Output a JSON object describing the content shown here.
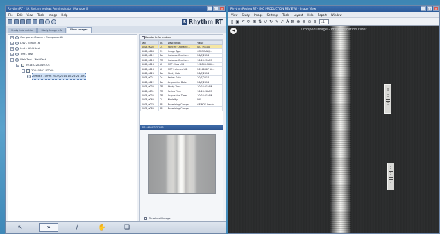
{
  "left_window": {
    "title": "Rhythm RT - [IA Rhythm review: Administrator (Manager)]",
    "menu": [
      "File",
      "Edit",
      "View",
      "Tools",
      "Image",
      "Help"
    ],
    "brand": "Rhythm RT",
    "tabs": [
      "Study Information",
      "Study Image Info",
      "View Images"
    ],
    "tree": [
      {
        "label": "ComponentName - ComponentB",
        "indent": 0,
        "icon": "node"
      },
      {
        "label": "LNV - 5460716",
        "indent": 0,
        "icon": "node"
      },
      {
        "label": "test - Weld test",
        "indent": 0,
        "icon": "node"
      },
      {
        "label": "Test - Test",
        "indent": 0,
        "icon": "node"
      },
      {
        "label": "WeldTest - WeldTest",
        "indent": 0,
        "icon": "node"
      },
      {
        "label": "20140220/010101",
        "indent": 1,
        "icon": "folder"
      },
      {
        "label": "20140807 RT000",
        "indent": 2,
        "icon": "folder"
      },
      {
        "label": "Weld 8 10mm 2007/2014 10:26:21 AM",
        "indent": 3,
        "icon": "image",
        "selected": true
      }
    ],
    "header_panel": {
      "title": "Header Information",
      "columns": [
        "Tag",
        "VR",
        "Description",
        "Value"
      ],
      "rows": [
        [
          "0008,0005",
          "CS",
          "Specific Characte...",
          "ISO_IR 100"
        ],
        [
          "0008,0008",
          "CS",
          "Image Type",
          "ORIGINAL\\P..."
        ],
        [
          "0008,0012",
          "DA",
          "Instance Creatio...",
          "20/7/2014"
        ],
        [
          "0008,0013",
          "TM",
          "Instance Creatio...",
          "10:28:21 AM"
        ],
        [
          "0008,0016",
          "UI",
          "SOP Class UID",
          "1.2.840.1000..."
        ],
        [
          "0008,0018",
          "UI",
          "SOP Instance UID",
          "20140807 10..."
        ],
        [
          "0008,0020",
          "DA",
          "Study Date",
          "20/7/2014"
        ],
        [
          "0008,0021",
          "DA",
          "Series Date",
          "20/7/2014"
        ],
        [
          "0008,0022",
          "DA",
          "Acquisition Date",
          "20/7/2014"
        ],
        [
          "0008,0030",
          "TM",
          "Study Time",
          "10:28:21 AM"
        ],
        [
          "0008,0031",
          "TM",
          "Series Time",
          "10:28:20 AM"
        ],
        [
          "0008,0032",
          "TM",
          "Acquisition Time",
          "10:28:21 AM"
        ],
        [
          "0008,0060",
          "CS",
          "Modality",
          "DX"
        ],
        [
          "0008,0070",
          "PN",
          "Examining Compa...",
          "GE NDE Servic"
        ],
        [
          "0008,0080",
          "PN",
          "Examining Compa...",
          ""
        ]
      ],
      "highlight_row": 0
    },
    "thumbnail": {
      "title": "20140807 RT000",
      "checkbox_label": "Thumbnail Image"
    },
    "status_buttons": [
      {
        "icon": "pointer-icon",
        "glyph": "↖"
      },
      {
        "icon": "window-level-icon",
        "glyph": "»",
        "active": true
      },
      {
        "icon": "measure-icon",
        "glyph": "∕"
      },
      {
        "icon": "hand-icon",
        "glyph": "✋"
      },
      {
        "icon": "trash-icon",
        "glyph": "❑"
      }
    ]
  },
  "right_window": {
    "title": "Rhythm Review RT - [NO PRODUCTION REVIEW] - Image View",
    "menu": [
      "View",
      "Study",
      "Image",
      "Settings",
      "Tools",
      "Layout",
      "Help",
      "Report",
      "Window"
    ],
    "zoom": "1:1",
    "overlay_text": "Cropped Image - Pre-Application Filter"
  }
}
